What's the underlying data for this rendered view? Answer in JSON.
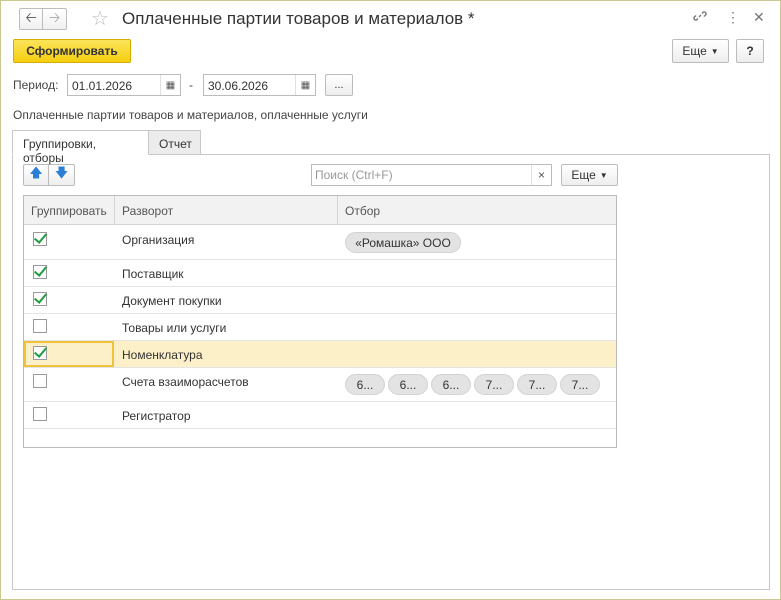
{
  "window": {
    "title": "Оплаченные партии товаров и материалов *",
    "back_icon": "arrow-left-icon",
    "forward_icon": "arrow-right-icon",
    "favorite_icon": "star-icon",
    "link_icon": "link-icon",
    "menu_icon": "more-vertical-icon",
    "close_icon": "close-icon"
  },
  "toolbar": {
    "generate_label": "Сформировать",
    "more_label": "Еще",
    "help_label": "?"
  },
  "period": {
    "label": "Период:",
    "from": "01.01.2026",
    "dash": "-",
    "to": "30.06.2026",
    "dots_label": "..."
  },
  "report_title": "Оплаченные партии товаров и материалов, оплаченные услуги",
  "tabs": [
    {
      "label": "Группировки, отборы",
      "active": true
    },
    {
      "label": "Отчет",
      "active": false
    }
  ],
  "panel": {
    "search_placeholder": "Поиск (Ctrl+F)",
    "clear_label": "×",
    "more_label": "Еще"
  },
  "grid": {
    "columns": [
      "Группировать",
      "Разворот",
      "Отбор"
    ],
    "rows": [
      {
        "checked": true,
        "name": "Организация",
        "filters": [
          "«Ромашка» ООО"
        ]
      },
      {
        "checked": true,
        "name": "Поставщик",
        "filters": []
      },
      {
        "checked": true,
        "name": "Документ покупки",
        "filters": []
      },
      {
        "checked": false,
        "name": "Товары или услуги",
        "filters": []
      },
      {
        "checked": true,
        "name": "Номенклатура",
        "filters": [],
        "selected": true
      },
      {
        "checked": false,
        "name": "Счета взаиморасчетов",
        "filters": [
          "6...",
          "6...",
          "6...",
          "7...",
          "7...",
          "7..."
        ]
      },
      {
        "checked": false,
        "name": "Регистратор",
        "filters": []
      }
    ]
  },
  "colors": {
    "primary_button": "#f5cf10",
    "selected_row": "#fbf0c7",
    "check": "#1f9d3f",
    "arrow": "#2c7fd6"
  }
}
